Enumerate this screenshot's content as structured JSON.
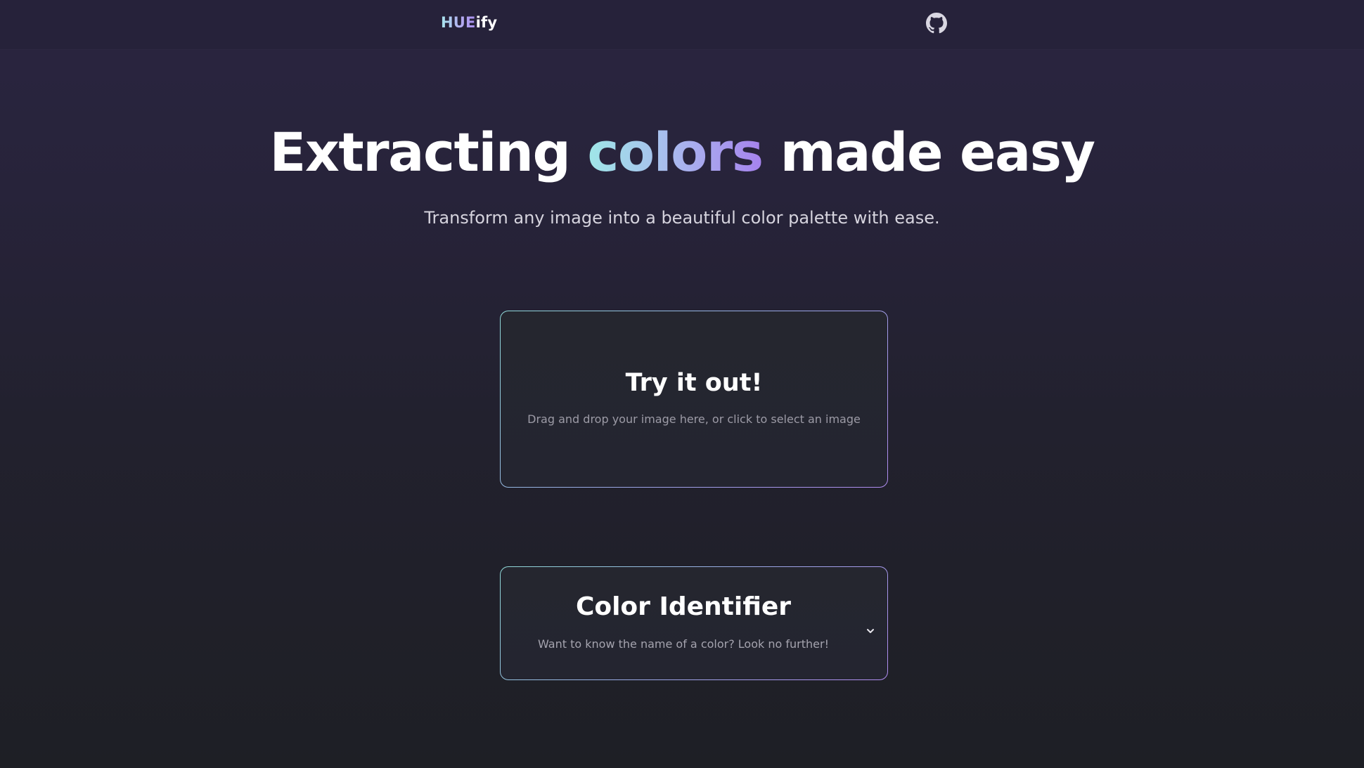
{
  "header": {
    "logo_hue": "HUE",
    "logo_ify": "ify",
    "github_icon": "github-icon"
  },
  "hero": {
    "title_before": "Extracting",
    "title_accent": "colors",
    "title_after": "made easy",
    "subtitle": "Transform any image into a beautiful color palette with ease."
  },
  "dropzone": {
    "title": "Try it out!",
    "description": "Drag and drop your image here, or click to select an image"
  },
  "color_identifier": {
    "title": "Color Identifier",
    "description": "Want to know the name of a color? Look no further!",
    "toggle_icon": "chevron-down-icon"
  },
  "colors": {
    "background_top": "#2a2540",
    "background_bottom": "#1e1f25",
    "accent_start": "#9fe7e8",
    "accent_end": "#a682ee",
    "card_background": "#252630"
  }
}
